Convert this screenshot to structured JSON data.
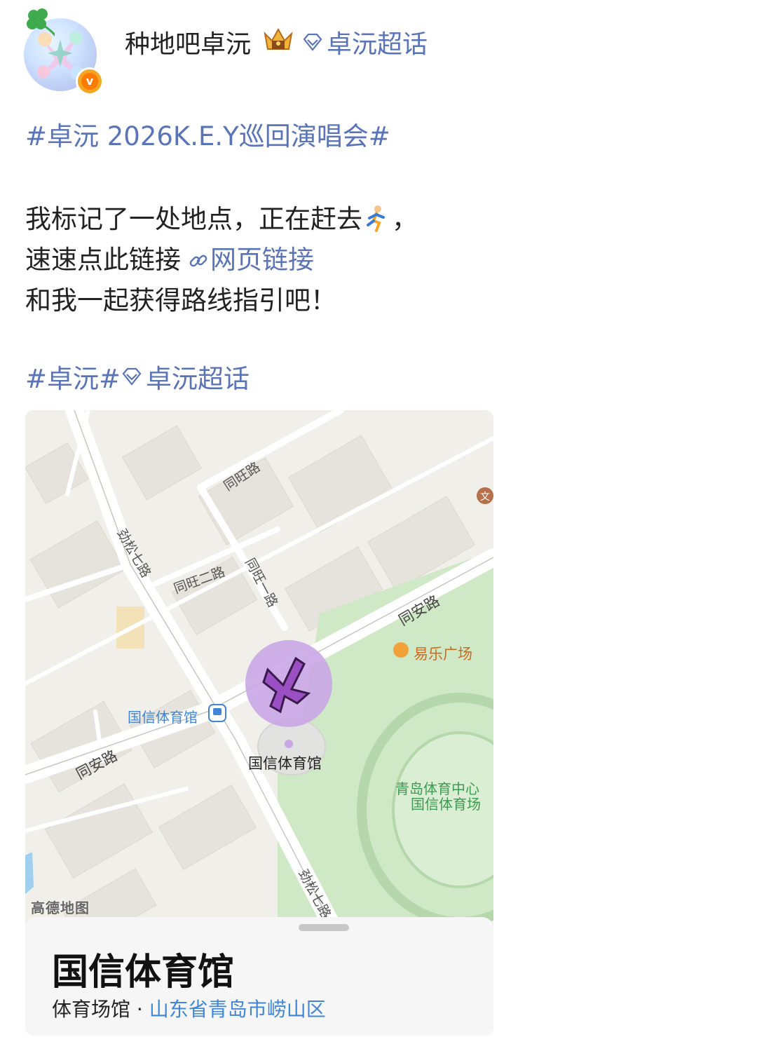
{
  "post": {
    "username": "种地吧卓沅",
    "super_topic": "卓沅超话",
    "hashtag_line": "#卓沅 2026K.E.Y巡回演唱会#",
    "line1": "我标记了一处地点，正在赶去",
    "line1_end": "，",
    "line2_prefix": "速速点此链接",
    "line2_link": "网页链接",
    "line3": "和我一起获得路线指引吧！",
    "tags_hashtag": "#卓沅#",
    "tags_super_topic": "卓沅超话"
  },
  "icons": {
    "verify": "v",
    "crown": "crown-icon",
    "diamond": "diamond-icon",
    "run": "running-person-icon",
    "link": "chain-link-icon"
  },
  "colors": {
    "link": "#5a74b8",
    "address": "#3f86d6",
    "park": "#cfe8c6",
    "marker": "#c9a6e6"
  },
  "map": {
    "brand": "高德地图",
    "labels": {
      "tongwang_road": "同旺路",
      "jinsong_7_top": "劲松七路",
      "tongwang_2": "同旺二路",
      "tongwang_1": "同旺一路",
      "tongan_right": "同安路",
      "yile_plaza": "易乐广场",
      "metro_station": "国信体育馆",
      "tongan_left": "同安路",
      "venue": "国信体育馆",
      "sports_center_1": "青岛体育中心",
      "sports_center_2": "国信体育场",
      "jinsong_7_bottom": "劲松七路",
      "culture_poi": "文"
    },
    "place": {
      "name": "国信体育馆",
      "category": "体育场馆",
      "separator": "·",
      "address": "山东省青岛市崂山区"
    }
  }
}
